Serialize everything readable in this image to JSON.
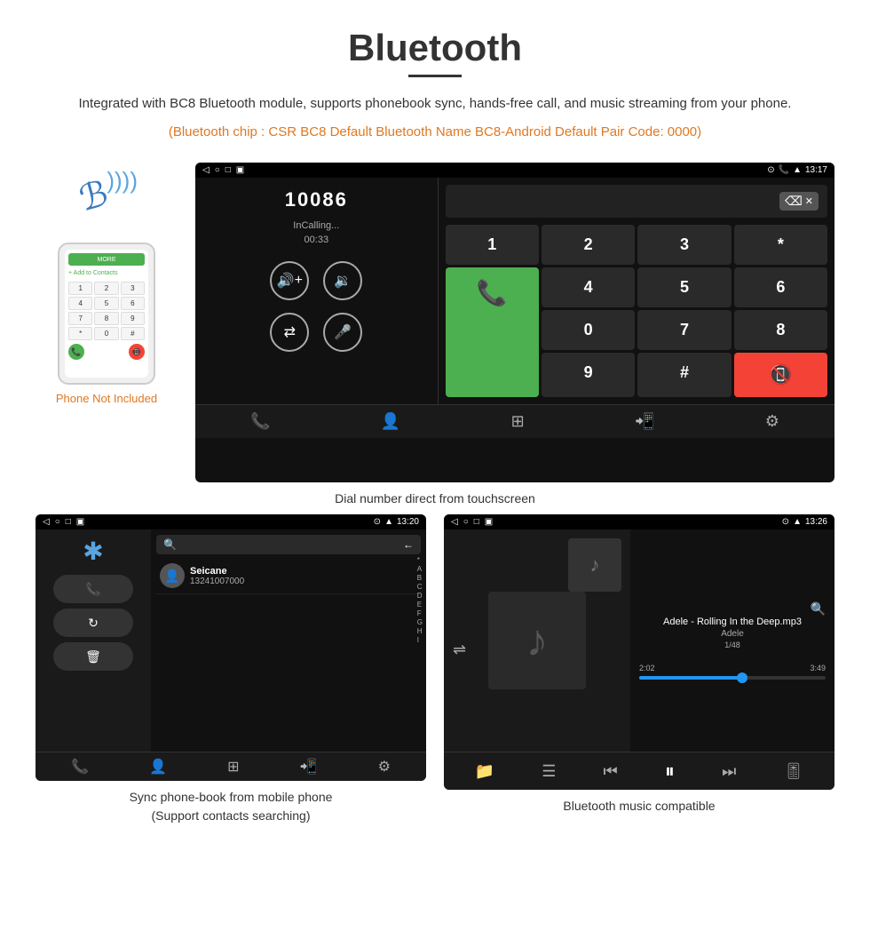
{
  "page": {
    "title": "Bluetooth",
    "subtitle": "Integrated with BC8 Bluetooth module, supports phonebook sync, hands-free call, and music streaming from your phone.",
    "orange_note": "(Bluetooth chip : CSR BC8    Default Bluetooth Name BC8-Android    Default Pair Code: 0000)",
    "phone_not_included": "Phone Not Included",
    "dial_caption": "Dial number direct from touchscreen",
    "contacts_caption": "Sync phone-book from mobile phone\n(Support contacts searching)",
    "music_caption": "Bluetooth music compatible"
  },
  "dial_screen": {
    "status_time": "13:17",
    "phone_number": "10086",
    "call_status": "InCalling...",
    "timer": "00:33",
    "keys": [
      "1",
      "2",
      "3",
      "*",
      "4",
      "5",
      "6",
      "0",
      "7",
      "8",
      "9",
      "#"
    ]
  },
  "contacts_screen": {
    "status_time": "13:20",
    "contact_name": "Seicane",
    "contact_number": "13241007000",
    "alpha_index": [
      "*",
      "A",
      "B",
      "C",
      "D",
      "E",
      "F",
      "G",
      "H",
      "I"
    ]
  },
  "music_screen": {
    "status_time": "13:26",
    "song_title": "Adele - Rolling In the Deep.mp3",
    "artist": "Adele",
    "track_count": "1/48",
    "current_time": "2:02",
    "total_time": "3:49",
    "progress_percent": 55
  },
  "icons": {
    "bluetooth": "✱",
    "phone": "📞",
    "back": "◁",
    "home": "○",
    "recent": "□",
    "search": "🔍",
    "contacts_icon": "👤",
    "grid_icon": "⊞",
    "transfer": "⇄",
    "settings_gear": "⚙",
    "mic": "🎤",
    "volume_up": "🔊",
    "volume_down": "🔉",
    "shuffle": "⇌",
    "prev": "⏮",
    "play": "⏸",
    "next": "⏭",
    "eq": "🎚",
    "folder": "📁",
    "list": "☰",
    "delete": "🗑",
    "music_note": "♪",
    "call_transfer": "📲"
  }
}
